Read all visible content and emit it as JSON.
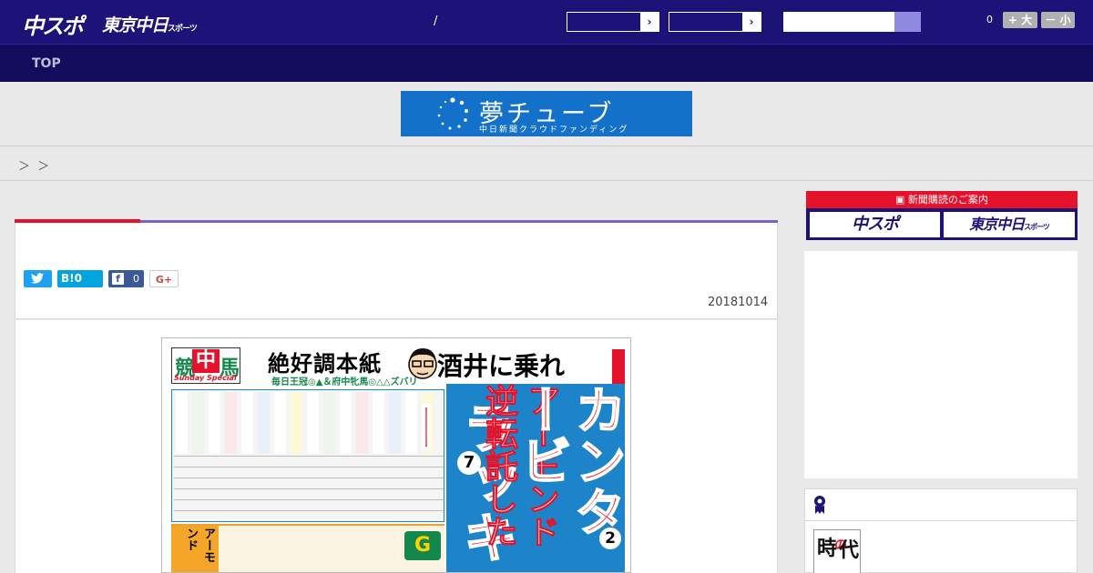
{
  "header": {
    "logo_main": "中スポ",
    "logo_tokyo": "東京中日",
    "logo_tokyo_suffix": "スポーツ",
    "slash": "/",
    "select_arrow": "›",
    "font_count": "0",
    "font_large_label": "+ 大",
    "font_small_label": "－ 小"
  },
  "nav": {
    "top_label": "TOP"
  },
  "banner": {
    "title": "夢チューブ",
    "subtitle": "中日新聞クラウドファンディング"
  },
  "breadcrumb": {
    "text": "＞ ＞"
  },
  "article": {
    "share": {
      "hatena_label": "B!",
      "hatena_count": "0",
      "facebook_count": "0",
      "gplus_label": "G+"
    },
    "date": "20181014",
    "image": {
      "logo_green1": "競",
      "logo_red": "中",
      "logo_green2": "馬",
      "logo_sub": "Sunday Special",
      "headline1": "絶好調本紙",
      "headline1_sub": "毎日王冠◎▲＆府中牝馬◎△△ズバリ",
      "headline2": "酒井に乗れ",
      "big_red1": "カンタービ",
      "mid_white": "アーモンド逆転託した",
      "big_red2": "ラッキー",
      "num7": "7",
      "num2": "2",
      "lower_box": "アーモンド",
      "lower_g": "G"
    }
  },
  "sidebar": {
    "subscribe_heading": "新聞購読のご案内",
    "subscribe_chuspo": "中スポ",
    "subscribe_tokyo": "東京中日",
    "subscribe_tokyo_suffix": "スポーツ",
    "rank_thumb": {
      "char1": "時",
      "char2": "の",
      "char3": "代"
    }
  },
  "colors": {
    "header_bg": "#1c1277",
    "nav_bg": "#130c5c",
    "accent_red": "#e4122a",
    "accent_purple": "#7a62c8",
    "banner_blue": "#1371c9",
    "twitter": "#1da1f2",
    "hatena": "#00a4de",
    "facebook": "#3b5998"
  }
}
